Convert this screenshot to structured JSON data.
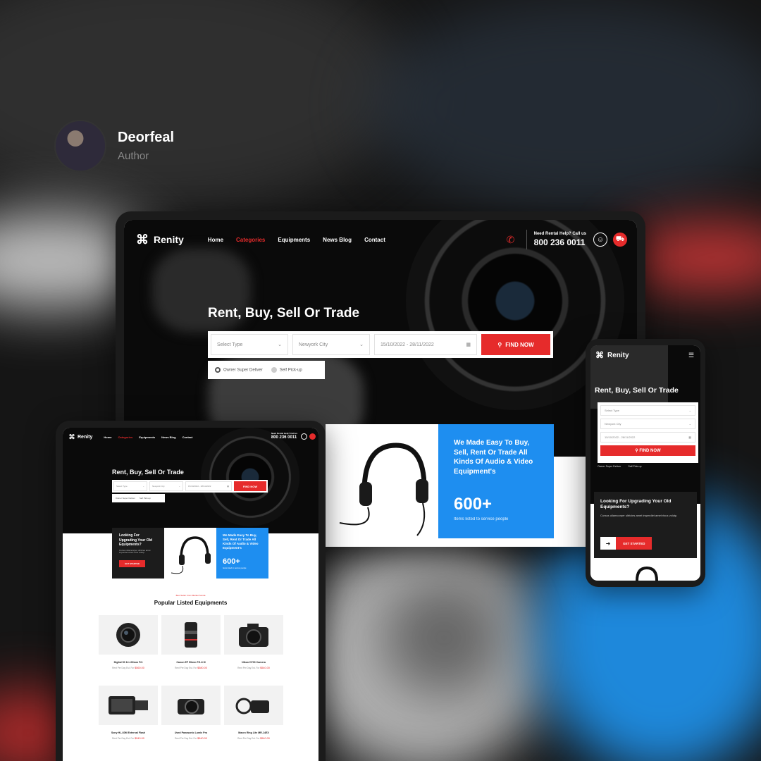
{
  "author": {
    "name": "Deorfeal",
    "role": "Author"
  },
  "site": {
    "brand": "Renity",
    "nav": [
      "Home",
      "Categories",
      "Equipments",
      "News Blog",
      "Contact"
    ],
    "help_label": "Need Rental Help? Call us",
    "help_number": "800 236 0011",
    "hero_title": "Rent, Buy, Sell Or Trade",
    "search": {
      "type_placeholder": "Select Type",
      "city_value": "Newyork City",
      "date_value": "15/10/2022 - 28/11/2022",
      "find_label": "FIND NOW"
    },
    "options": [
      "Owner Super Deliver",
      "Self Pick-up"
    ],
    "promo": {
      "title": "We Made Easy To Buy, Sell, Rent Or Trade All Kinds Of Audio & Video Equipment's",
      "count": "600+",
      "count_label": "Items listed to service people"
    },
    "upgrade": {
      "title": "Looking For Upgrading Your Old Equipments?",
      "text": "Cursus ullamcorper ultricies amet imperdiet amet risus volutp.",
      "button": "GET STARTED"
    },
    "popular": {
      "subtitle": "Best Seller From Market Sonda",
      "title": "Popular Listed Equipments",
      "items": [
        {
          "name": "Digital 50 12-100mm F/4",
          "old": "Rent Per Day Est. For",
          "price": "$560.00"
        },
        {
          "name": "Canon EF 50mm F/1.8 III",
          "old": "Rent Per Day Est. For",
          "price": "$580.00"
        },
        {
          "name": "Nikon D700 Camera",
          "old": "Rent Per Day Est. For",
          "price": "$540.00"
        },
        {
          "name": "Sony HL-60M External Flash",
          "old": "Rent Per Day Est. For",
          "price": "$540.00"
        },
        {
          "name": "Used Panasonic Lumix Pro",
          "old": "Rent Per Day Est. For",
          "price": "$540.00"
        },
        {
          "name": "Macro Ring Lite MR-14EX",
          "old": "Rent Per Day Est. For",
          "price": "$540.00"
        }
      ]
    }
  },
  "colors": {
    "accent": "#e62b2b",
    "blue": "#1e8ef0",
    "dark": "#0a0a0a"
  },
  "icons": [
    "logo-icon",
    "phone-icon",
    "user-icon",
    "cart-icon",
    "search-icon",
    "calendar-icon",
    "chevron-down-icon",
    "menu-icon",
    "arrow-right-icon"
  ]
}
